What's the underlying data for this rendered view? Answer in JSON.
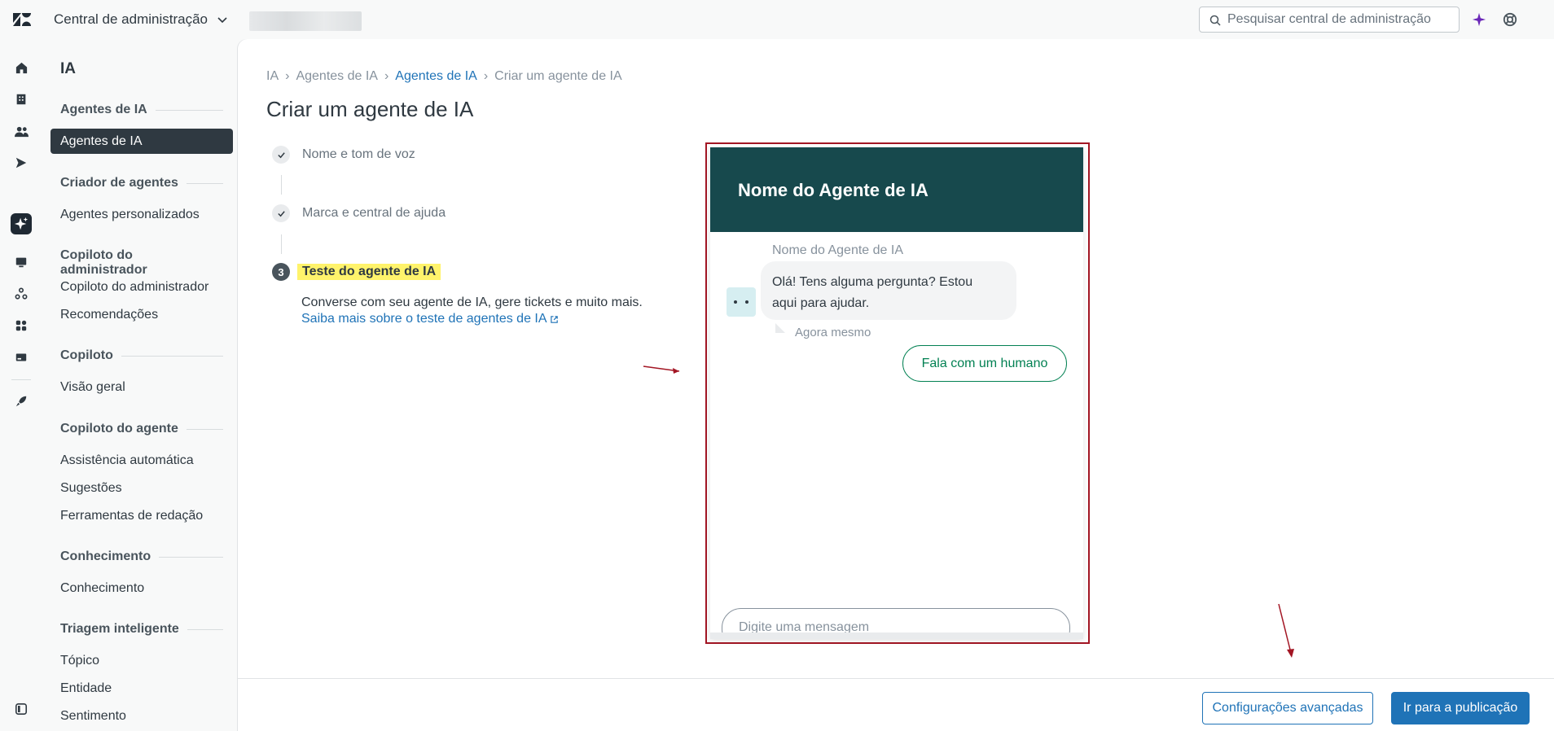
{
  "topbar": {
    "product_name": "Central de administração",
    "search_placeholder": "Pesquisar central de administração"
  },
  "nav": {
    "title": "IA",
    "groups": [
      {
        "label": "Agentes de IA",
        "items": [
          "Agentes de IA"
        ]
      },
      {
        "label": "Criador de agentes",
        "items": [
          "Agentes personalizados"
        ]
      },
      {
        "label": "Copiloto do administrador",
        "items": [
          "Copiloto do administrador",
          "Recomendações"
        ]
      },
      {
        "label": "Copiloto",
        "items": [
          "Visão geral"
        ]
      },
      {
        "label": "Copiloto do agente",
        "items": [
          "Assistência automática",
          "Sugestões",
          "Ferramentas de redação"
        ]
      },
      {
        "label": "Conhecimento",
        "items": [
          "Conhecimento"
        ]
      },
      {
        "label": "Triagem inteligente",
        "items": [
          "Tópico",
          "Entidade",
          "Sentimento"
        ]
      }
    ]
  },
  "breadcrumb": [
    "IA",
    "Agentes de IA",
    "Agentes de IA",
    "Criar um agente de IA"
  ],
  "page_title": "Criar um agente de IA",
  "steps": [
    {
      "label": "Nome e tom de voz",
      "state": "done"
    },
    {
      "label": "Marca e central de ajuda",
      "state": "done"
    },
    {
      "number": "3",
      "label": "Teste do agente de IA",
      "state": "current"
    }
  ],
  "step_description": "Converse com seu agente de IA, gere tickets e muito mais.",
  "step_link": "Saiba mais sobre o teste de agentes de IA",
  "widget": {
    "header_title": "Nome do Agente de IA",
    "bot_name": "Nome do Agente de IA",
    "message_line1": "Olá! Tens alguma pergunta? Estou",
    "message_line2": "aqui para ajudar.",
    "timestamp": "Agora mesmo",
    "human_button": "Fala com um humano",
    "input_placeholder": "Digite uma mensagem"
  },
  "footer": {
    "secondary_button": "Configurações avançadas",
    "primary_button": "Ir para a publicação"
  },
  "colors": {
    "accent_blue": "#1f73b7",
    "widget_header": "#17494d",
    "highlight": "#fff36b",
    "annotation_red": "#a31624",
    "green": "#038153"
  }
}
